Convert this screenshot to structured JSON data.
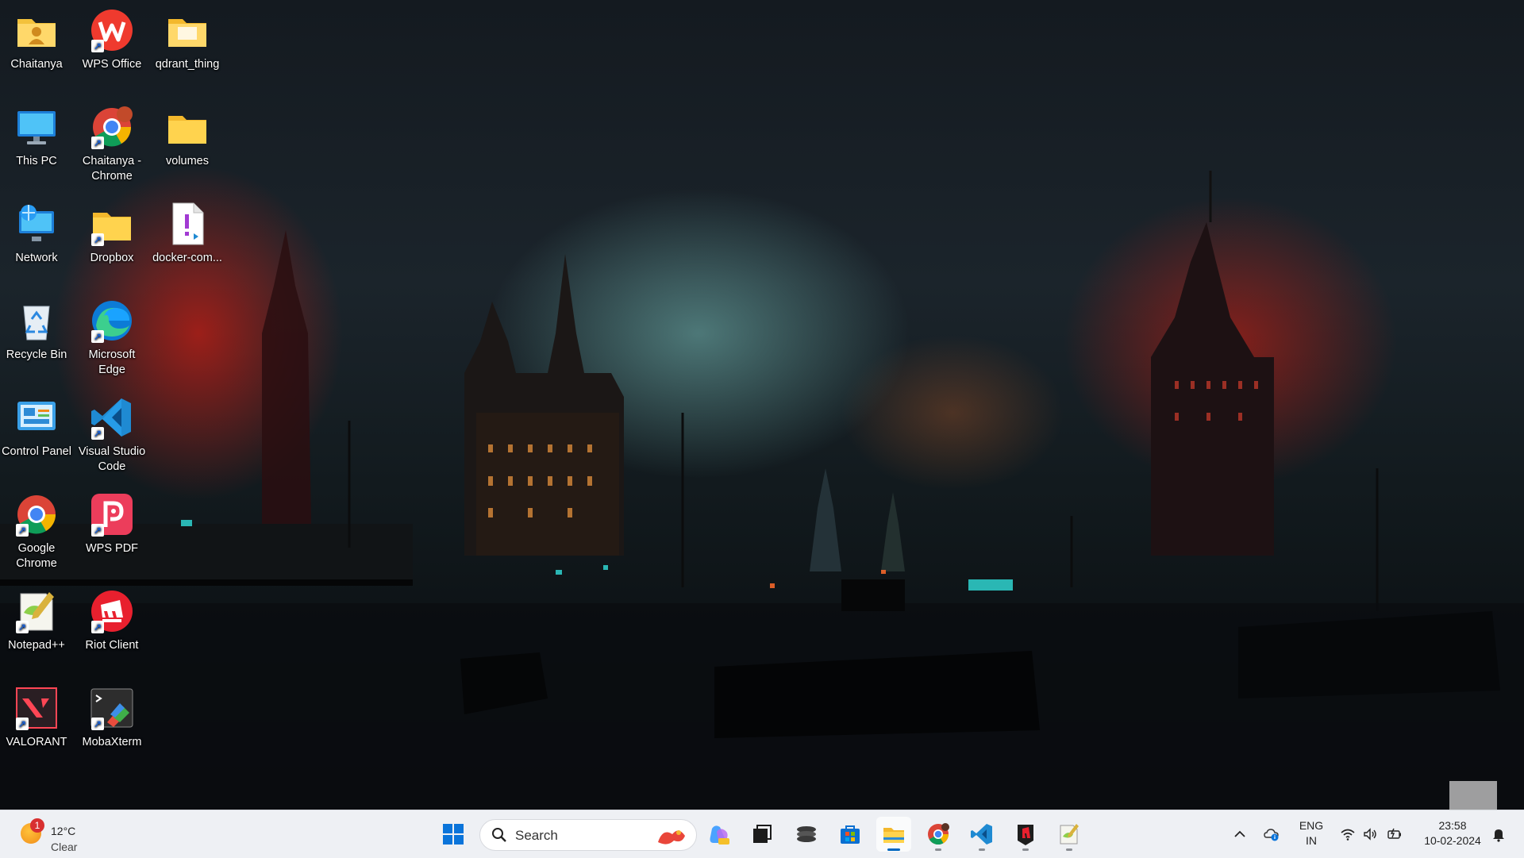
{
  "desktop": {
    "icons": [
      {
        "label": "Chaitanya",
        "icon": "user-folder-icon"
      },
      {
        "label": "WPS Office",
        "icon": "wps-office-icon"
      },
      {
        "label": "qdrant_thing",
        "icon": "folder-icon"
      },
      {
        "label": "This PC",
        "icon": "monitor-icon"
      },
      {
        "label": "Chaitanya - Chrome",
        "icon": "chrome-profile-icon"
      },
      {
        "label": "volumes",
        "icon": "folder-icon"
      },
      {
        "label": "Network",
        "icon": "network-icon"
      },
      {
        "label": "Dropbox",
        "icon": "folder-icon"
      },
      {
        "label": "docker-com...",
        "icon": "yaml-file-icon"
      },
      {
        "label": "Recycle Bin",
        "icon": "recycle-bin-icon"
      },
      {
        "label": "Microsoft Edge",
        "icon": "edge-icon"
      },
      {
        "label": "Control Panel",
        "icon": "control-panel-icon"
      },
      {
        "label": "Visual Studio Code",
        "icon": "vscode-icon"
      },
      {
        "label": "Google Chrome",
        "icon": "chrome-icon"
      },
      {
        "label": "WPS PDF",
        "icon": "wps-pdf-icon"
      },
      {
        "label": "Notepad++",
        "icon": "notepadpp-icon"
      },
      {
        "label": "Riot Client",
        "icon": "riot-client-icon"
      },
      {
        "label": "VALORANT",
        "icon": "valorant-icon"
      },
      {
        "label": "MobaXterm",
        "icon": "mobaxterm-icon"
      }
    ]
  },
  "taskbar": {
    "weather": {
      "temp": "12°C",
      "condition": "Clear",
      "badge": "1"
    },
    "search": {
      "label": "Search"
    },
    "apps": [
      {
        "name": "start",
        "icon": "windows-start-icon"
      },
      {
        "name": "copilot",
        "icon": "copilot-icon"
      },
      {
        "name": "task-view",
        "icon": "task-view-icon"
      },
      {
        "name": "terminal-stack",
        "icon": "stack-icon"
      },
      {
        "name": "microsoft-store",
        "icon": "store-icon"
      },
      {
        "name": "file-explorer",
        "icon": "file-explorer-icon"
      },
      {
        "name": "chrome",
        "icon": "chrome-icon"
      },
      {
        "name": "vscode",
        "icon": "vscode-icon"
      },
      {
        "name": "riot-client",
        "icon": "riot-client-icon"
      },
      {
        "name": "notepadpp",
        "icon": "notepadpp-icon"
      }
    ],
    "tray": {
      "lang_line1": "ENG",
      "lang_line2": "IN",
      "time": "23:58",
      "date": "10-02-2024"
    }
  },
  "colors": {
    "accent": "#0067c0",
    "taskbar_bg": "#eef0f4"
  }
}
